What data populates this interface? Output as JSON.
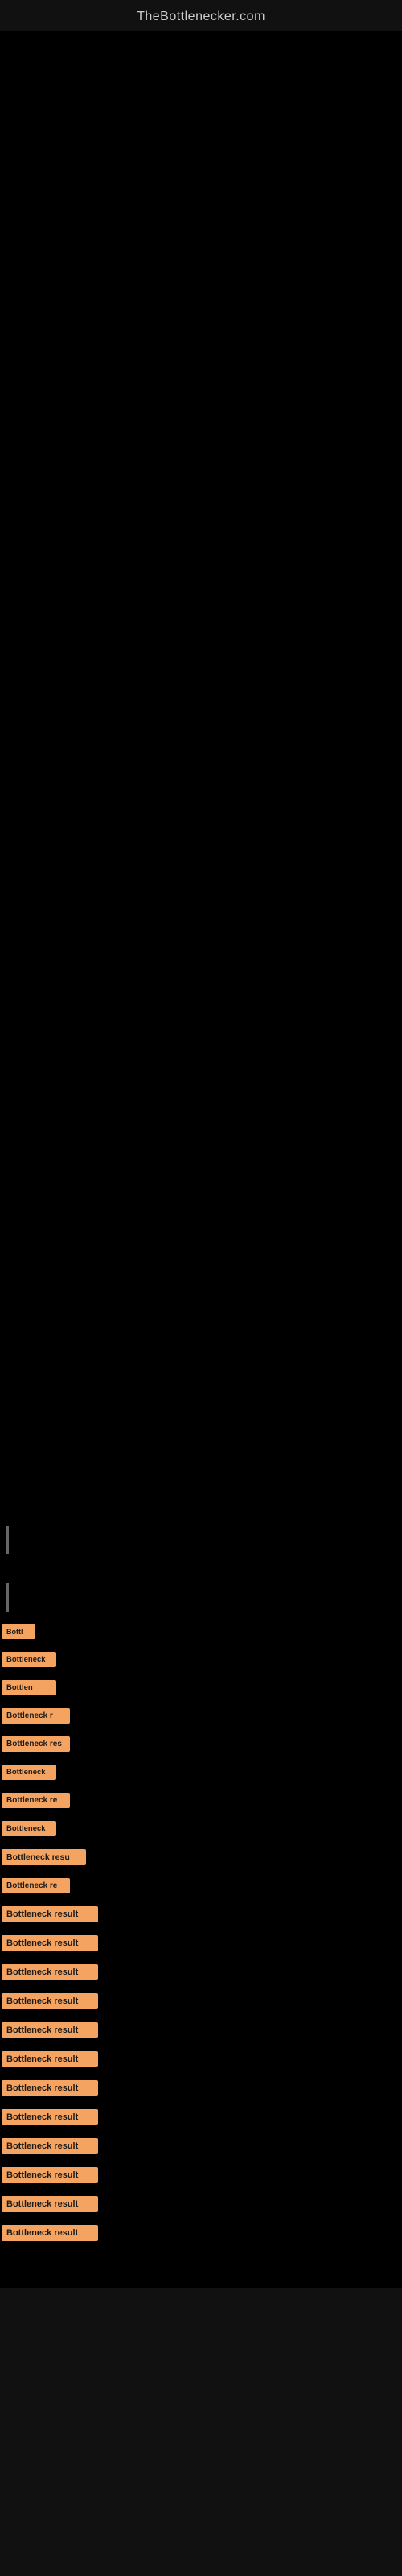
{
  "site": {
    "title": "TheBottlenecker.com"
  },
  "badges": [
    {
      "id": 1,
      "label": "Bottl",
      "size": "badge-xs"
    },
    {
      "id": 2,
      "label": "Bottleneck",
      "size": "badge-sm"
    },
    {
      "id": 3,
      "label": "Bottlen",
      "size": "badge-sm"
    },
    {
      "id": 4,
      "label": "Bottleneck r",
      "size": "badge-md"
    },
    {
      "id": 5,
      "label": "Bottleneck res",
      "size": "badge-md"
    },
    {
      "id": 6,
      "label": "Bottleneck",
      "size": "badge-sm"
    },
    {
      "id": 7,
      "label": "Bottleneck re",
      "size": "badge-md"
    },
    {
      "id": 8,
      "label": "Bottleneck",
      "size": "badge-sm"
    },
    {
      "id": 9,
      "label": "Bottleneck resu",
      "size": "badge-lg"
    },
    {
      "id": 10,
      "label": "Bottleneck re",
      "size": "badge-md"
    },
    {
      "id": 11,
      "label": "Bottleneck result",
      "size": "badge-xl"
    },
    {
      "id": 12,
      "label": "Bottleneck result",
      "size": "badge-xl"
    },
    {
      "id": 13,
      "label": "Bottleneck result",
      "size": "badge-xl"
    },
    {
      "id": 14,
      "label": "Bottleneck result",
      "size": "badge-xl"
    },
    {
      "id": 15,
      "label": "Bottleneck result",
      "size": "badge-xl"
    },
    {
      "id": 16,
      "label": "Bottleneck result",
      "size": "badge-xl"
    },
    {
      "id": 17,
      "label": "Bottleneck result",
      "size": "badge-xl"
    },
    {
      "id": 18,
      "label": "Bottleneck result",
      "size": "badge-xl"
    },
    {
      "id": 19,
      "label": "Bottleneck result",
      "size": "badge-xl"
    },
    {
      "id": 20,
      "label": "Bottleneck result",
      "size": "badge-xl"
    },
    {
      "id": 21,
      "label": "Bottleneck result",
      "size": "badge-xl"
    },
    {
      "id": 22,
      "label": "Bottleneck result",
      "size": "badge-xl"
    }
  ]
}
